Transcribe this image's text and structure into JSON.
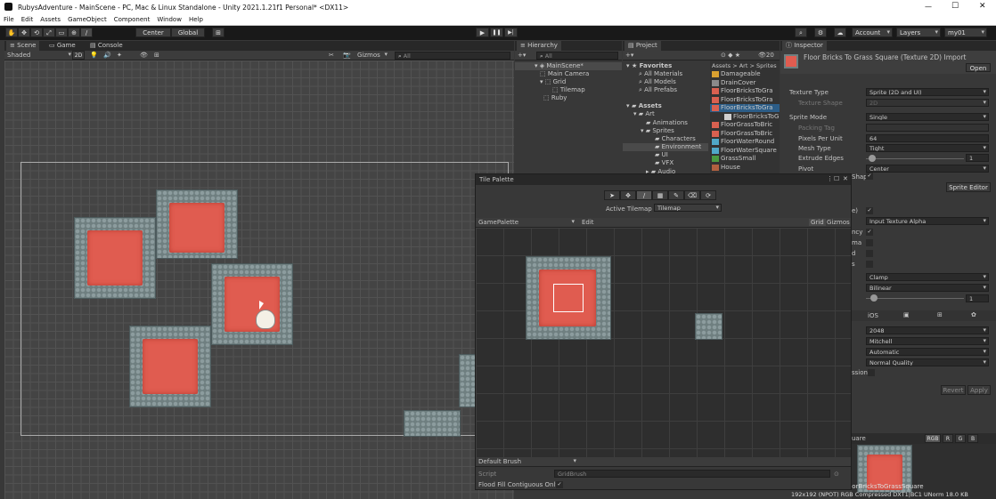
{
  "window": {
    "title": "RubysAdventure - MainScene - PC, Mac & Linux Standalone - Unity 2021.1.21f1 Personal* <DX11>",
    "minimize": "—",
    "maximize": "☐",
    "close": "✕"
  },
  "menu": [
    "File",
    "Edit",
    "Assets",
    "GameObject",
    "Component",
    "Window",
    "Help"
  ],
  "toolbar": {
    "tools": [
      "✋",
      "✥",
      "⟲",
      "⤢",
      "▭",
      "⊕",
      "/"
    ],
    "center_label": "Center",
    "global_label": "Global",
    "play": "▶",
    "pause": "❚❚",
    "step": "▶|",
    "account": "Account",
    "layers": "Layers",
    "layout": "my01"
  },
  "scene": {
    "tabs": [
      "Scene",
      "Game",
      "Console"
    ],
    "shading": "Shaded",
    "mode2d": "2D",
    "gizmos": "Gizmos",
    "search_placeholder": "All"
  },
  "hierarchy": {
    "tab": "Hierarchy",
    "search_placeholder": "All",
    "items": [
      {
        "label": "MainScene*",
        "indent": 0
      },
      {
        "label": "Main Camera",
        "indent": 1
      },
      {
        "label": "Grid",
        "indent": 1
      },
      {
        "label": "Tilemap",
        "indent": 2
      },
      {
        "label": "Ruby",
        "indent": 1
      }
    ]
  },
  "project": {
    "tab": "Project",
    "count": "20",
    "breadcrumb": "Assets > Art > Sprites",
    "tree": [
      {
        "label": "Favorites",
        "indent": 0,
        "bold": true
      },
      {
        "label": "All Materials",
        "indent": 1
      },
      {
        "label": "All Models",
        "indent": 1
      },
      {
        "label": "All Prefabs",
        "indent": 1
      },
      {
        "label": "Assets",
        "indent": 0,
        "bold": true
      },
      {
        "label": "Art",
        "indent": 1
      },
      {
        "label": "Animations",
        "indent": 2
      },
      {
        "label": "Sprites",
        "indent": 2
      },
      {
        "label": "Characters",
        "indent": 3
      },
      {
        "label": "Environment",
        "indent": 3,
        "selected": true
      },
      {
        "label": "UI",
        "indent": 3
      },
      {
        "label": "VFX",
        "indent": 3
      },
      {
        "label": "Audio",
        "indent": 2
      }
    ],
    "files": [
      {
        "label": "Damageable",
        "color": "#d8a030"
      },
      {
        "label": "DrainCover",
        "color": "#8a8a8a"
      },
      {
        "label": "FloorBricksToGra",
        "color": "#d86050"
      },
      {
        "label": "FloorBricksToGra",
        "color": "#d86050"
      },
      {
        "label": "FloorBricksToGra",
        "color": "#d86050",
        "selected": true
      },
      {
        "label": "FloorBricksToG",
        "color": "#cfcfcf",
        "child": true
      },
      {
        "label": "FloorGrassToBric",
        "color": "#d86050"
      },
      {
        "label": "FloorGrassToBric",
        "color": "#d86050"
      },
      {
        "label": "FloorWaterRound",
        "color": "#50a8c8"
      },
      {
        "label": "FloorWaterSquare",
        "color": "#50a8c8"
      },
      {
        "label": "GrassSmall",
        "color": "#4a9a40"
      },
      {
        "label": "House",
        "color": "#b06040"
      }
    ]
  },
  "inspector": {
    "tab": "Inspector",
    "asset_title": "Floor Bricks To Grass Square (Texture 2D) Import",
    "open_button": "Open",
    "rows": [
      {
        "label": "Texture Type",
        "value": "Sprite (2D and UI)"
      },
      {
        "label": "Texture Shape",
        "value": "2D",
        "disabled": true
      },
      {
        "label": "Sprite Mode",
        "value": "Single"
      },
      {
        "label": "Packing Tag",
        "value": "",
        "disabled": true
      },
      {
        "label": "Pixels Per Unit",
        "value": "64"
      },
      {
        "label": "Mesh Type",
        "value": "Tight"
      },
      {
        "label": "Extrude Edges",
        "value": "1"
      },
      {
        "label": "Pivot",
        "value": "Center"
      }
    ],
    "generate_physics_shape": "Shap",
    "sprite_editor": "Sprite Editor",
    "partial_rows": [
      {
        "label": "e)",
        "value": ""
      },
      {
        "label": "",
        "value": "Input Texture Alpha"
      },
      {
        "label": "ncy",
        "value": ""
      },
      {
        "label": "ma",
        "value": ""
      },
      {
        "label": "d",
        "value": ""
      },
      {
        "label": "s",
        "value": ""
      }
    ],
    "wrap_mode": "Clamp",
    "filter_mode": "Bilinear",
    "aniso": "1",
    "platform_tab": "iOS",
    "max_size": "2048",
    "resize": "Mitchell",
    "format": "Automatic",
    "compression": "Normal Quality",
    "partial_label": "ssion",
    "revert": "Revert",
    "apply": "Apply",
    "preview_name": "oorBricksToGrassSquare",
    "preview_info": "192x192 (NPOT)  RGB Compressed DXT1|BC1 UNorm  18.0 KB",
    "channels": [
      "RGB",
      "R",
      "G",
      "B"
    ],
    "partial_preview_label": "uare"
  },
  "tile_palette": {
    "title": "Tile Palette",
    "tools": [
      "➤",
      "✥",
      "/",
      "▦",
      "✎",
      "⌫",
      "⟳"
    ],
    "active_tilemap_label": "Active Tilemap",
    "active_tilemap": "Tilemap",
    "palette": "GamePalette",
    "edit": "Edit",
    "grid": "Grid",
    "gizmos": "Gizmos",
    "brush": "Default Brush",
    "script_label": "Script",
    "script_value": "GridBrush",
    "flood_fill_label": "Flood Fill Contiguous Only",
    "flood_fill": true
  },
  "colors": {
    "accent_blue": "#2c5d87",
    "tile_red": "#e05c50",
    "tile_stone": "#6f7f80",
    "panel": "#383838",
    "dark": "#191919"
  }
}
